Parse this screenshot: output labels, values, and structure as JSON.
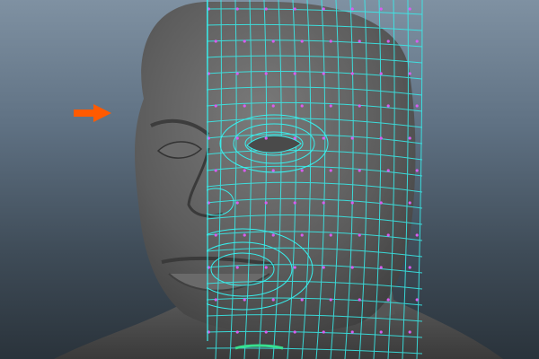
{
  "viewport": {
    "background_top": "#7f91a2",
    "background_bottom": "#2a333b"
  },
  "model": {
    "surface_color": "#5e5e5e",
    "wire_edge_color": "#37f0ee",
    "vertex_color": "#d85cf0",
    "selected_edge_color": "#37e08f"
  },
  "annotation": {
    "arrow_icon": "arrow-right-icon",
    "arrow_color": "#ff5a00"
  }
}
